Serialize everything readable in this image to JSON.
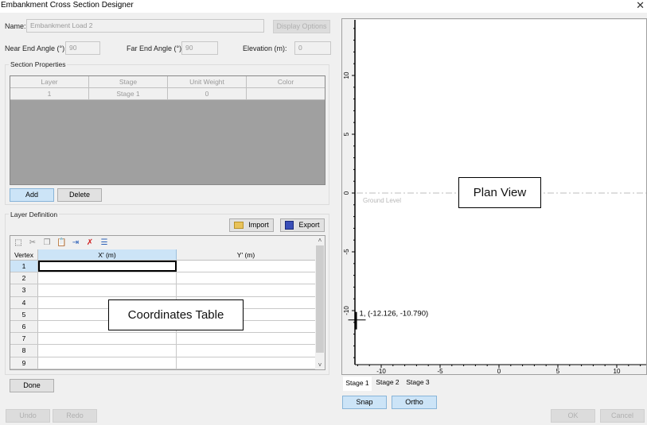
{
  "window": {
    "title": "Embankment Cross Section Designer",
    "close_icon": "close-icon"
  },
  "form": {
    "name_label": "Name:",
    "name_value": "Embankment Load 2",
    "display_options_label": "Display Options",
    "near_end_angle_label": "Near End Angle (°):",
    "near_end_angle_value": "90",
    "far_end_angle_label": "Far End Angle (°):",
    "far_end_angle_value": "90",
    "elevation_label": "Elevation (m):",
    "elevation_value": "0"
  },
  "section_properties": {
    "title": "Section Properties",
    "columns": [
      "Layer",
      "Stage",
      "Unit Weight",
      "Color"
    ],
    "rows": [
      [
        "1",
        "Stage 1",
        "0",
        ""
      ]
    ],
    "add_label": "Add",
    "delete_label": "Delete"
  },
  "layer_definition": {
    "title": "Layer Definition",
    "import_label": "Import",
    "export_label": "Export",
    "toolbar_icons": [
      "select-all-icon",
      "cut-icon",
      "copy-icon",
      "paste-icon",
      "insert-row-icon",
      "delete-row-icon",
      "append-row-icon"
    ],
    "columns": {
      "vertex": "Vertex",
      "x": "X' (m)",
      "y": "Y' (m)"
    },
    "rows": [
      {
        "vertex": "1",
        "x": "",
        "y": ""
      },
      {
        "vertex": "2",
        "x": "",
        "y": ""
      },
      {
        "vertex": "3",
        "x": "",
        "y": ""
      },
      {
        "vertex": "4",
        "x": "",
        "y": ""
      },
      {
        "vertex": "5",
        "x": "",
        "y": ""
      },
      {
        "vertex": "6",
        "x": "",
        "y": ""
      },
      {
        "vertex": "7",
        "x": "",
        "y": ""
      },
      {
        "vertex": "8",
        "x": "",
        "y": ""
      },
      {
        "vertex": "9",
        "x": "",
        "y": ""
      }
    ]
  },
  "callouts": {
    "coordinates_table": "Coordinates Table",
    "plan_view": "Plan View"
  },
  "plot": {
    "ground_level_label": "Ground Level",
    "x_ticks": [
      "-10",
      "-5",
      "0",
      "5",
      "10"
    ],
    "y_ticks": [
      "10",
      "5",
      "0",
      "-5",
      "-10"
    ],
    "x_tick_values": [
      -10,
      -5,
      0,
      5,
      10
    ],
    "y_tick_values": [
      10,
      5,
      0,
      -5,
      -10
    ],
    "cursor_readout": "1, (-12.126, -10.790)",
    "cursor_x": -12.126,
    "cursor_y": -10.79
  },
  "stage_tabs": [
    "Stage 1",
    "Stage 2",
    "Stage 3"
  ],
  "buttons": {
    "done": "Done",
    "undo": "Undo",
    "redo": "Redo",
    "snap": "Snap",
    "ortho": "Ortho",
    "ok": "OK",
    "cancel": "Cancel"
  }
}
